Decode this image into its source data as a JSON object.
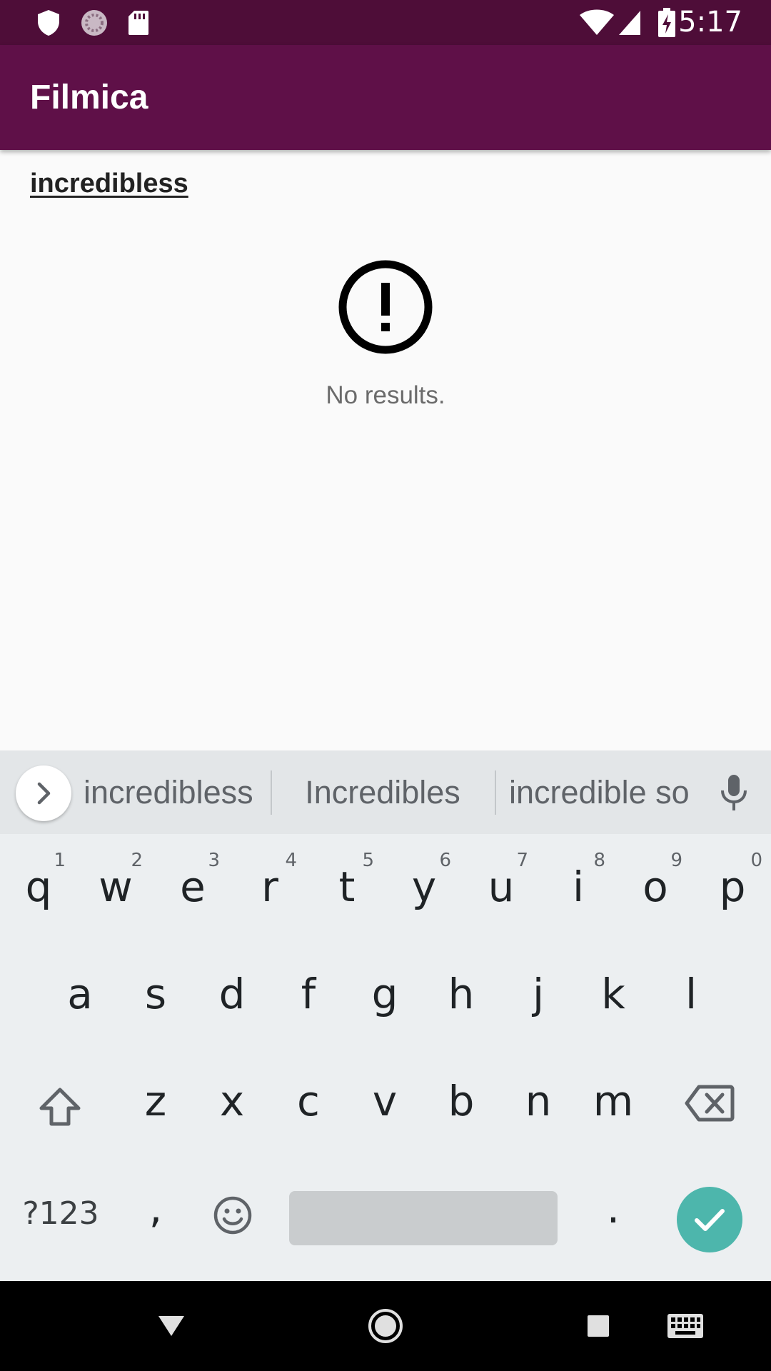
{
  "status_bar": {
    "time": "5:17",
    "icons": [
      "shield-icon",
      "sync-icon",
      "sd-card-icon",
      "wifi-icon",
      "signal-icon",
      "battery-charging-icon"
    ]
  },
  "app_bar": {
    "title": "Filmica"
  },
  "search": {
    "query": "incredibless"
  },
  "empty_state": {
    "icon": "alert-circle-icon",
    "message": "No results."
  },
  "keyboard": {
    "suggestions": [
      "incredibless",
      "Incredibles",
      "incredible so"
    ],
    "row1": [
      {
        "key": "q",
        "hint": "1"
      },
      {
        "key": "w",
        "hint": "2"
      },
      {
        "key": "e",
        "hint": "3"
      },
      {
        "key": "r",
        "hint": "4"
      },
      {
        "key": "t",
        "hint": "5"
      },
      {
        "key": "y",
        "hint": "6"
      },
      {
        "key": "u",
        "hint": "7"
      },
      {
        "key": "i",
        "hint": "8"
      },
      {
        "key": "o",
        "hint": "9"
      },
      {
        "key": "p",
        "hint": "0"
      }
    ],
    "row2": [
      "a",
      "s",
      "d",
      "f",
      "g",
      "h",
      "j",
      "k",
      "l"
    ],
    "row3": [
      "z",
      "x",
      "c",
      "v",
      "b",
      "n",
      "m"
    ],
    "symbols_label": "?123",
    "comma": ",",
    "period": ".",
    "accent_color": "#4db6ac"
  },
  "colors": {
    "status_bar": "#4e0d38",
    "app_bar": "#5f1048",
    "background": "#fafafa"
  }
}
